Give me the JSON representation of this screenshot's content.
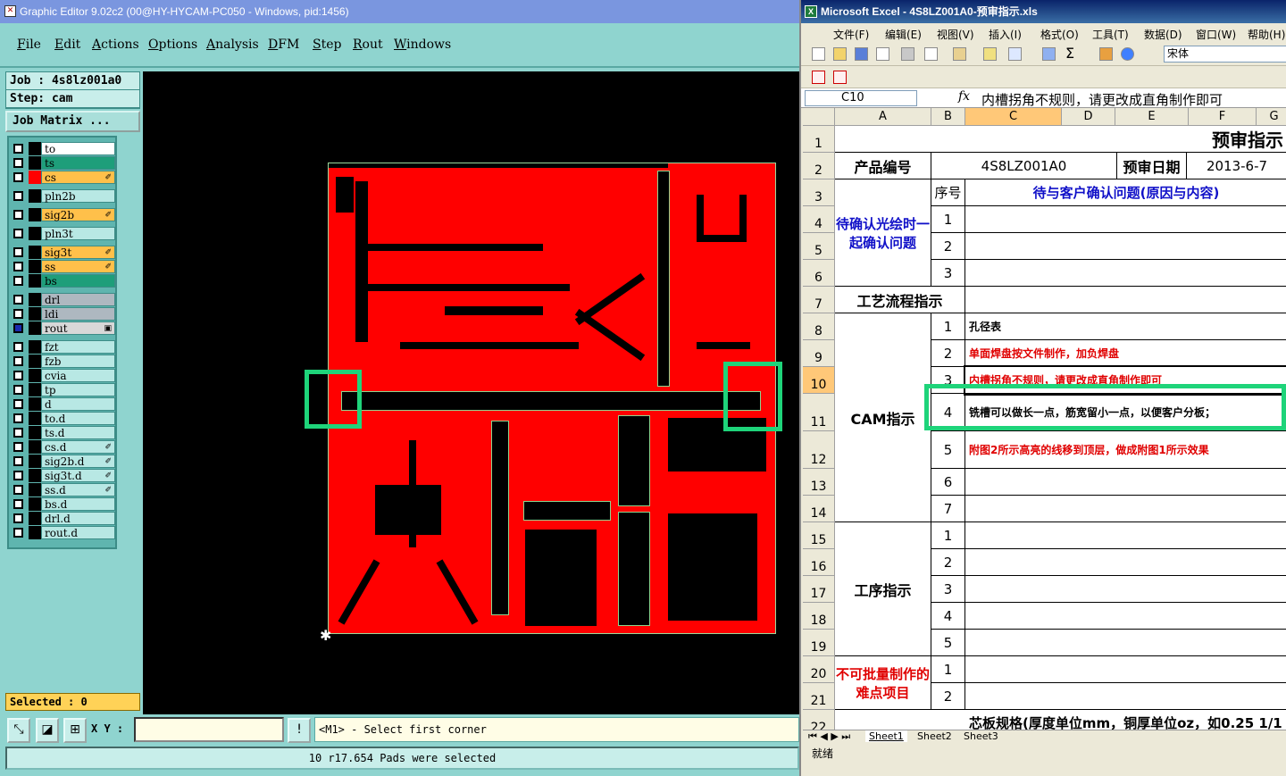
{
  "graphic_editor": {
    "title": "Graphic Editor 9.02c2 (00@HY-HYCAM-PC050 - Windows, pid:1456)",
    "menu": [
      "File",
      "Edit",
      "Actions",
      "Options",
      "Analysis",
      "DFM",
      "Step",
      "Rout",
      "Windows"
    ],
    "job": "Job : 4s8lz001a0",
    "step": "Step: cam",
    "job_matrix": "Job Matrix ...",
    "layers": [
      {
        "name": "to",
        "color": "#ffffff"
      },
      {
        "name": "ts",
        "color": "#1e9e7a"
      },
      {
        "name": "cs",
        "color": "#ffc04a",
        "marker": "✐"
      },
      {
        "name": "pln2b",
        "color": "#b8e8e4"
      },
      {
        "name": "sig2b",
        "color": "#ffc04a",
        "marker": "✐"
      },
      {
        "name": "pln3t",
        "color": "#b8e8e4"
      },
      {
        "name": "sig3t",
        "color": "#ffc04a",
        "marker": "✐"
      },
      {
        "name": "ss",
        "color": "#ffc04a",
        "marker": "✐"
      },
      {
        "name": "bs",
        "color": "#1e9e7a"
      },
      {
        "name": "drl",
        "color": "#aeb8c0"
      },
      {
        "name": "ldi",
        "color": "#aeb8c0"
      },
      {
        "name": "rout",
        "color": "#d8d8d8",
        "marker": "▣"
      },
      {
        "name": "fzt",
        "color": "#b8e8e4"
      },
      {
        "name": "fzb",
        "color": "#b8e8e4"
      },
      {
        "name": "cvia",
        "color": "#b8e8e4"
      },
      {
        "name": "tp",
        "color": "#b8e8e4"
      },
      {
        "name": "d",
        "color": "#b8e8e4"
      },
      {
        "name": "to.d",
        "color": "#b8e8e4"
      },
      {
        "name": "ts.d",
        "color": "#b8e8e4"
      },
      {
        "name": "cs.d",
        "color": "#b8e8e4",
        "marker": "✐"
      },
      {
        "name": "sig2b.d",
        "color": "#b8e8e4",
        "marker": "✐"
      },
      {
        "name": "sig3t.d",
        "color": "#b8e8e4",
        "marker": "✐"
      },
      {
        "name": "ss.d",
        "color": "#b8e8e4",
        "marker": "✐"
      },
      {
        "name": "bs.d",
        "color": "#b8e8e4"
      },
      {
        "name": "drl.d",
        "color": "#b8e8e4"
      },
      {
        "name": "rout.d",
        "color": "#b8e8e4"
      }
    ],
    "selected": "Selected : 0",
    "xy_label": "X Y :",
    "xy_value": "",
    "prompt": "<M1> - Select first corner",
    "status": "10 r17.654 Pads were selected",
    "board_color": "#ff0000",
    "highlight_color": "#1ed47a"
  },
  "excel": {
    "title": "Microsoft Excel - 4S8LZ001A0-预审指示.xls",
    "menu": [
      "文件(F)",
      "编辑(E)",
      "视图(V)",
      "插入(I)",
      "格式(O)",
      "工具(T)",
      "数据(D)",
      "窗口(W)",
      "帮助(H)"
    ],
    "font_name": "宋体",
    "name_box": "C10",
    "fx": "fx",
    "formula": "内槽拐角不规则，请更改成直角制作即可",
    "columns": [
      "A",
      "B",
      "C",
      "D",
      "E",
      "F",
      "G"
    ],
    "rows": [
      "1",
      "2",
      "3",
      "4",
      "5",
      "6",
      "7",
      "8",
      "9",
      "10",
      "11",
      "12",
      "13",
      "14",
      "15",
      "16",
      "17",
      "18",
      "19",
      "20",
      "21",
      "22"
    ],
    "sheet_title": "预审指示",
    "product_label": "产品编号",
    "product_no": "4S8LZ001A0",
    "date_label": "预审日期",
    "date": "2013-6-7",
    "seq_label": "序号",
    "confirm_header": "待与客户确认问题(原因与内容)",
    "confirm_label": "待确认光绘时一起确认问题",
    "process_label": "工艺流程指示",
    "cam_label": "CAM指示",
    "procedure_label": "工序指示",
    "difficult_label": "不可批量制作的难点项目",
    "cam_items": [
      {
        "no": "1",
        "text": "孔径表",
        "color": "#000000"
      },
      {
        "no": "2",
        "text": "单面焊盘按文件制作，加负焊盘",
        "color": "#e00000"
      },
      {
        "no": "3",
        "text": "内槽拐角不规则，请更改成直角制作即可",
        "color": "#e00000"
      },
      {
        "no": "4",
        "text": "铣槽可以做长一点，筋宽留小一点，以便客户分板；",
        "color": "#000000"
      },
      {
        "no": "5",
        "text": "附图2所示高亮的线移到顶层，做成附图1所示效果",
        "color": "#e00000"
      },
      {
        "no": "6",
        "text": "",
        "color": "#000000"
      },
      {
        "no": "7",
        "text": "",
        "color": "#000000"
      }
    ],
    "confirm_nums": [
      "1",
      "2",
      "3"
    ],
    "procedure_nums": [
      "1",
      "2",
      "3",
      "4",
      "5"
    ],
    "difficult_nums": [
      "1",
      "2"
    ],
    "row22_text": "芯板规格(厚度单位mm，铜厚单位oz，如0.25 1/1",
    "sheets": [
      "Sheet1",
      "Sheet2",
      "Sheet3"
    ],
    "status": "就绪"
  }
}
